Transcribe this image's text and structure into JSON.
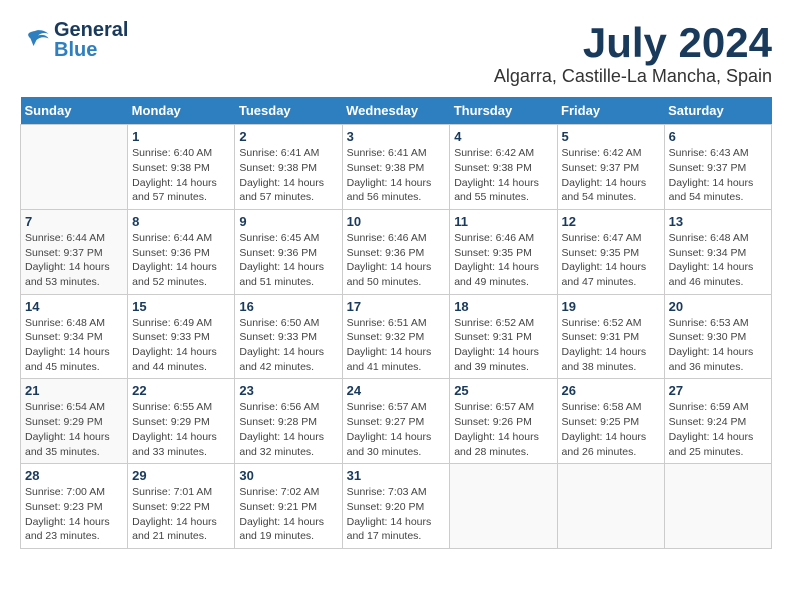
{
  "logo": {
    "general": "General",
    "blue": "Blue"
  },
  "title": "July 2024",
  "location": "Algarra, Castille-La Mancha, Spain",
  "headers": [
    "Sunday",
    "Monday",
    "Tuesday",
    "Wednesday",
    "Thursday",
    "Friday",
    "Saturday"
  ],
  "weeks": [
    [
      {
        "day": "",
        "info": ""
      },
      {
        "day": "1",
        "info": "Sunrise: 6:40 AM\nSunset: 9:38 PM\nDaylight: 14 hours\nand 57 minutes."
      },
      {
        "day": "2",
        "info": "Sunrise: 6:41 AM\nSunset: 9:38 PM\nDaylight: 14 hours\nand 57 minutes."
      },
      {
        "day": "3",
        "info": "Sunrise: 6:41 AM\nSunset: 9:38 PM\nDaylight: 14 hours\nand 56 minutes."
      },
      {
        "day": "4",
        "info": "Sunrise: 6:42 AM\nSunset: 9:38 PM\nDaylight: 14 hours\nand 55 minutes."
      },
      {
        "day": "5",
        "info": "Sunrise: 6:42 AM\nSunset: 9:37 PM\nDaylight: 14 hours\nand 54 minutes."
      },
      {
        "day": "6",
        "info": "Sunrise: 6:43 AM\nSunset: 9:37 PM\nDaylight: 14 hours\nand 54 minutes."
      }
    ],
    [
      {
        "day": "7",
        "info": "Sunrise: 6:44 AM\nSunset: 9:37 PM\nDaylight: 14 hours\nand 53 minutes."
      },
      {
        "day": "8",
        "info": "Sunrise: 6:44 AM\nSunset: 9:36 PM\nDaylight: 14 hours\nand 52 minutes."
      },
      {
        "day": "9",
        "info": "Sunrise: 6:45 AM\nSunset: 9:36 PM\nDaylight: 14 hours\nand 51 minutes."
      },
      {
        "day": "10",
        "info": "Sunrise: 6:46 AM\nSunset: 9:36 PM\nDaylight: 14 hours\nand 50 minutes."
      },
      {
        "day": "11",
        "info": "Sunrise: 6:46 AM\nSunset: 9:35 PM\nDaylight: 14 hours\nand 49 minutes."
      },
      {
        "day": "12",
        "info": "Sunrise: 6:47 AM\nSunset: 9:35 PM\nDaylight: 14 hours\nand 47 minutes."
      },
      {
        "day": "13",
        "info": "Sunrise: 6:48 AM\nSunset: 9:34 PM\nDaylight: 14 hours\nand 46 minutes."
      }
    ],
    [
      {
        "day": "14",
        "info": "Sunrise: 6:48 AM\nSunset: 9:34 PM\nDaylight: 14 hours\nand 45 minutes."
      },
      {
        "day": "15",
        "info": "Sunrise: 6:49 AM\nSunset: 9:33 PM\nDaylight: 14 hours\nand 44 minutes."
      },
      {
        "day": "16",
        "info": "Sunrise: 6:50 AM\nSunset: 9:33 PM\nDaylight: 14 hours\nand 42 minutes."
      },
      {
        "day": "17",
        "info": "Sunrise: 6:51 AM\nSunset: 9:32 PM\nDaylight: 14 hours\nand 41 minutes."
      },
      {
        "day": "18",
        "info": "Sunrise: 6:52 AM\nSunset: 9:31 PM\nDaylight: 14 hours\nand 39 minutes."
      },
      {
        "day": "19",
        "info": "Sunrise: 6:52 AM\nSunset: 9:31 PM\nDaylight: 14 hours\nand 38 minutes."
      },
      {
        "day": "20",
        "info": "Sunrise: 6:53 AM\nSunset: 9:30 PM\nDaylight: 14 hours\nand 36 minutes."
      }
    ],
    [
      {
        "day": "21",
        "info": "Sunrise: 6:54 AM\nSunset: 9:29 PM\nDaylight: 14 hours\nand 35 minutes."
      },
      {
        "day": "22",
        "info": "Sunrise: 6:55 AM\nSunset: 9:29 PM\nDaylight: 14 hours\nand 33 minutes."
      },
      {
        "day": "23",
        "info": "Sunrise: 6:56 AM\nSunset: 9:28 PM\nDaylight: 14 hours\nand 32 minutes."
      },
      {
        "day": "24",
        "info": "Sunrise: 6:57 AM\nSunset: 9:27 PM\nDaylight: 14 hours\nand 30 minutes."
      },
      {
        "day": "25",
        "info": "Sunrise: 6:57 AM\nSunset: 9:26 PM\nDaylight: 14 hours\nand 28 minutes."
      },
      {
        "day": "26",
        "info": "Sunrise: 6:58 AM\nSunset: 9:25 PM\nDaylight: 14 hours\nand 26 minutes."
      },
      {
        "day": "27",
        "info": "Sunrise: 6:59 AM\nSunset: 9:24 PM\nDaylight: 14 hours\nand 25 minutes."
      }
    ],
    [
      {
        "day": "28",
        "info": "Sunrise: 7:00 AM\nSunset: 9:23 PM\nDaylight: 14 hours\nand 23 minutes."
      },
      {
        "day": "29",
        "info": "Sunrise: 7:01 AM\nSunset: 9:22 PM\nDaylight: 14 hours\nand 21 minutes."
      },
      {
        "day": "30",
        "info": "Sunrise: 7:02 AM\nSunset: 9:21 PM\nDaylight: 14 hours\nand 19 minutes."
      },
      {
        "day": "31",
        "info": "Sunrise: 7:03 AM\nSunset: 9:20 PM\nDaylight: 14 hours\nand 17 minutes."
      },
      {
        "day": "",
        "info": ""
      },
      {
        "day": "",
        "info": ""
      },
      {
        "day": "",
        "info": ""
      }
    ]
  ]
}
